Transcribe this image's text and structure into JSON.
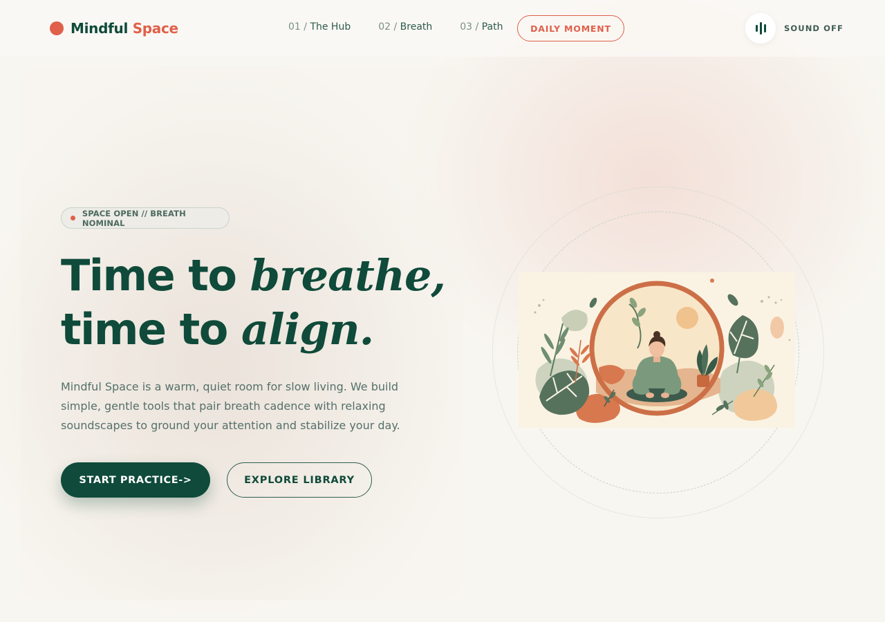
{
  "brand": {
    "name_part1": "Mindful",
    "name_part2": "Space"
  },
  "nav": {
    "items": [
      {
        "num": "01 /",
        "label": "The Hub"
      },
      {
        "num": "02 /",
        "label": "Breath"
      },
      {
        "num": "03 /",
        "label": "Path"
      }
    ],
    "cta": "DAILY MOMENT"
  },
  "sound": {
    "label": "SOUND OFF",
    "icon": "sound-bars-icon"
  },
  "hero": {
    "status": "SPACE OPEN // BREATH NOMINAL",
    "line1_plain": "Time to",
    "line1_italic": "breathe,",
    "line2_plain": "time to",
    "line2_italic": "align.",
    "lede": "Mindful Space is a warm, quiet room for slow living. We build simple, gentle tools that pair breath cadence with relaxing soundscapes to ground your attention and stabilize your day.",
    "primary_button": "START PRACTICE->",
    "secondary_button": "EXPLORE LIBRARY"
  },
  "colors": {
    "accent": "#e0604a",
    "primary": "#0f4a3a",
    "background": "#f8f6f1",
    "muted_text": "#55706a"
  }
}
